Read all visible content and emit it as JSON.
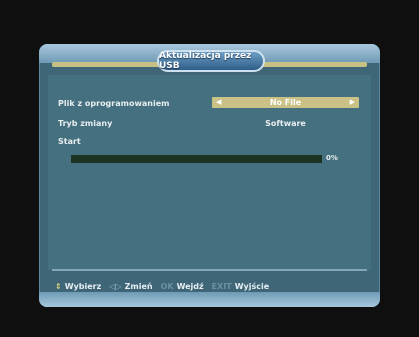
{
  "title": "Aktualizacja przez USB",
  "rows": [
    {
      "label": "Plik z oprogramowaniem"
    },
    {
      "label": "Tryb zmiany"
    },
    {
      "label": "Start"
    }
  ],
  "file_selector": {
    "value": "No File"
  },
  "mode_value": "Software",
  "progress": {
    "percent": 0,
    "label": "0%"
  },
  "footer": {
    "hints": [
      {
        "key": "⇕",
        "key_icon": "up-down-icon",
        "text": "Wybierz"
      },
      {
        "key": "◁▷",
        "key_icon": "left-right-icon",
        "text": "Zmień"
      },
      {
        "key": "OK",
        "key_icon": "ok-key",
        "text": "Wejdź"
      },
      {
        "key": "EXIT",
        "key_icon": "exit-key",
        "text": "Wyjście"
      }
    ]
  },
  "colors": {
    "panel": "#3e6677",
    "selector": "#c9c186",
    "progress_track": "#1d3324"
  }
}
